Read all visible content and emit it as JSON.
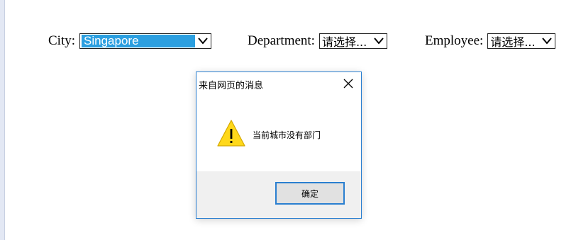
{
  "form": {
    "city": {
      "label": "City:",
      "value": "Singapore"
    },
    "department": {
      "label": "Department:",
      "value": "请选择..."
    },
    "employee": {
      "label": "Employee:",
      "value": "请选择..."
    }
  },
  "dialog": {
    "title": "来自网页的消息",
    "message": "当前城市没有部门",
    "ok_label": "确定",
    "icons": {
      "close": "close-icon",
      "status": "warning-icon",
      "dropdown": "chevron-down-icon"
    }
  },
  "colors": {
    "selection_highlight": "#2b9fe0",
    "dialog_border": "#2a7fd0",
    "warning_fill": "#ffd81a"
  }
}
